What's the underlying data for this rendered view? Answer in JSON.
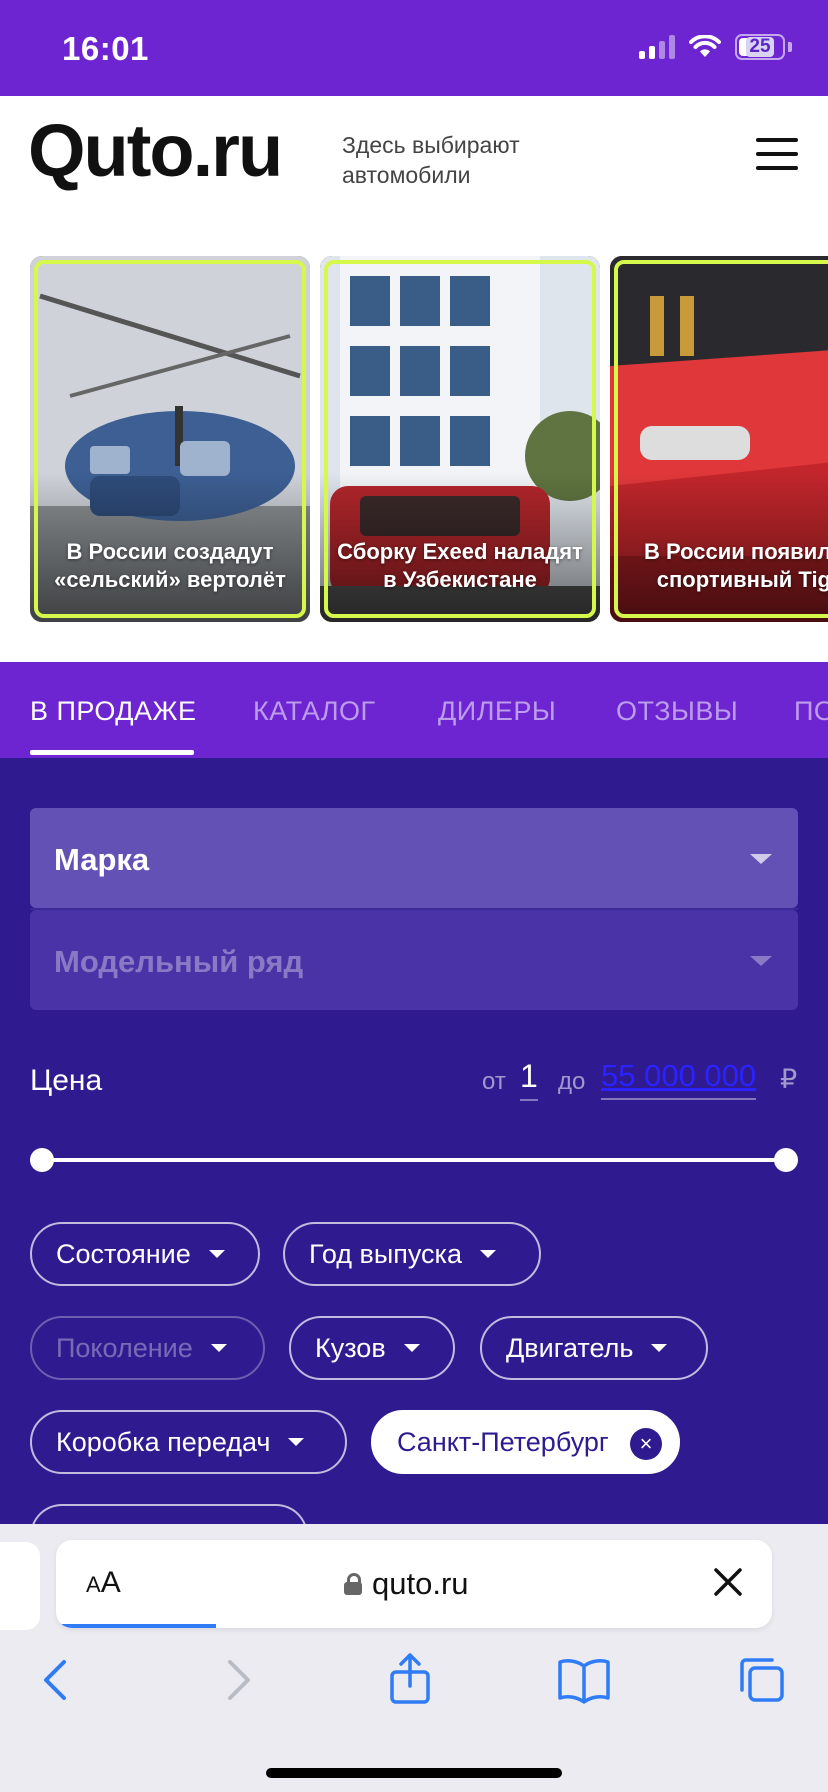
{
  "status_bar": {
    "time": "16:01",
    "battery": "25"
  },
  "header": {
    "logo": "Quto.ru",
    "tagline": "Здесь выбирают автомобили"
  },
  "stories": [
    {
      "title": "В России создадут «сельский» вертолёт"
    },
    {
      "title": "Сборку Exeed наладят в Узбекистане"
    },
    {
      "title": "В России появился спортивный Tiga"
    }
  ],
  "tabs": [
    {
      "label": "В ПРОДАЖЕ",
      "active": true
    },
    {
      "label": "КАТАЛОГ"
    },
    {
      "label": "ДИЛЕРЫ"
    },
    {
      "label": "ОТЗЫВЫ"
    },
    {
      "label": "ПО"
    }
  ],
  "filters": {
    "brand_placeholder": "Марка",
    "model_placeholder": "Модельный ряд",
    "price": {
      "label": "Цена",
      "from_label": "от",
      "from_value": "1",
      "to_label": "до",
      "to_value": "55 000 000",
      "currency": "₽"
    },
    "chips": [
      {
        "label": "Состояние"
      },
      {
        "label": "Год выпуска"
      },
      {
        "label": "Поколение",
        "disabled": true
      },
      {
        "label": "Кузов"
      },
      {
        "label": "Двигатель"
      },
      {
        "label": "Коробка передач"
      },
      {
        "label": "Санкт-Петербург",
        "selected": true
      }
    ]
  },
  "browser": {
    "text_size_button": "AA",
    "url": "qutoru",
    "url_display": "qutoru"
  },
  "colors": {
    "brand_purple": "#6d25d2",
    "filter_bg": "#2f1b8f",
    "story_frame": "#d6f84a",
    "link_blue": "#2a22ff"
  }
}
